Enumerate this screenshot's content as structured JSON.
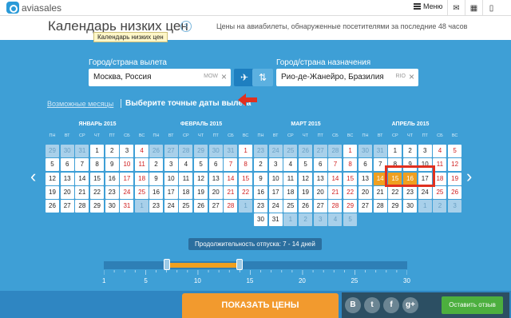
{
  "topbar": {
    "logo_text": "aviasales",
    "menu_label": "Меню",
    "icons": [
      "mail-icon",
      "calculator-icon",
      "mobile-icon"
    ]
  },
  "header": {
    "title": "Календарь низких цен",
    "help": "?",
    "subtitle": "Цены на авиабилеты, обнаруженные посетителями за последние 48 часов",
    "tooltip": "Календарь низких цен"
  },
  "search": {
    "origin_label": "Город/страна вылета",
    "origin_value": "Москва, Россия",
    "origin_code": "MOW",
    "dest_label": "Город/страна назначения",
    "dest_value": "Рио-де-Жанейро, Бразилия",
    "dest_code": "RIO",
    "clear_glyph": "×",
    "plane_glyph": "✈",
    "swap_glyph": "⇅"
  },
  "modes": {
    "months_link": "Возможные месяцы",
    "dates_active": "Выберите точные даты вылета"
  },
  "weekdays": [
    "ПН",
    "ВТ",
    "СР",
    "ЧТ",
    "ПТ",
    "СБ",
    "ВС"
  ],
  "months": [
    {
      "name": "ЯНВАРЬ 2015",
      "days": [
        [
          "29",
          "d"
        ],
        [
          "30",
          "d"
        ],
        [
          "31",
          "d"
        ],
        [
          "1",
          ""
        ],
        [
          "2",
          ""
        ],
        [
          "3",
          ""
        ],
        [
          "4",
          "w"
        ],
        [
          "5",
          ""
        ],
        [
          "6",
          ""
        ],
        [
          "7",
          ""
        ],
        [
          "8",
          ""
        ],
        [
          "9",
          ""
        ],
        [
          "10",
          "w"
        ],
        [
          "11",
          "w"
        ],
        [
          "12",
          ""
        ],
        [
          "13",
          ""
        ],
        [
          "14",
          ""
        ],
        [
          "15",
          ""
        ],
        [
          "16",
          ""
        ],
        [
          "17",
          "w"
        ],
        [
          "18",
          "w"
        ],
        [
          "19",
          ""
        ],
        [
          "20",
          ""
        ],
        [
          "21",
          ""
        ],
        [
          "22",
          ""
        ],
        [
          "23",
          ""
        ],
        [
          "24",
          "w"
        ],
        [
          "25",
          "w"
        ],
        [
          "26",
          ""
        ],
        [
          "27",
          ""
        ],
        [
          "28",
          ""
        ],
        [
          "29",
          ""
        ],
        [
          "30",
          ""
        ],
        [
          "31",
          "w"
        ],
        [
          "1",
          "d"
        ]
      ]
    },
    {
      "name": "ФЕВРАЛЬ 2015",
      "days": [
        [
          "26",
          "d"
        ],
        [
          "27",
          "d"
        ],
        [
          "28",
          "d"
        ],
        [
          "29",
          "d"
        ],
        [
          "30",
          "d"
        ],
        [
          "31",
          "d"
        ],
        [
          "1",
          "w"
        ],
        [
          "2",
          ""
        ],
        [
          "3",
          ""
        ],
        [
          "4",
          ""
        ],
        [
          "5",
          ""
        ],
        [
          "6",
          ""
        ],
        [
          "7",
          "w"
        ],
        [
          "8",
          "w"
        ],
        [
          "9",
          ""
        ],
        [
          "10",
          ""
        ],
        [
          "11",
          ""
        ],
        [
          "12",
          ""
        ],
        [
          "13",
          ""
        ],
        [
          "14",
          "w"
        ],
        [
          "15",
          "w"
        ],
        [
          "16",
          ""
        ],
        [
          "17",
          ""
        ],
        [
          "18",
          ""
        ],
        [
          "19",
          ""
        ],
        [
          "20",
          ""
        ],
        [
          "21",
          "w"
        ],
        [
          "22",
          "w"
        ],
        [
          "23",
          ""
        ],
        [
          "24",
          ""
        ],
        [
          "25",
          ""
        ],
        [
          "26",
          ""
        ],
        [
          "27",
          ""
        ],
        [
          "28",
          "w"
        ],
        [
          "1",
          "d"
        ]
      ]
    },
    {
      "name": "МАРТ 2015",
      "days": [
        [
          "23",
          "d"
        ],
        [
          "24",
          "d"
        ],
        [
          "25",
          "d"
        ],
        [
          "26",
          "d"
        ],
        [
          "27",
          "d"
        ],
        [
          "28",
          "d"
        ],
        [
          "1",
          "w"
        ],
        [
          "2",
          ""
        ],
        [
          "3",
          ""
        ],
        [
          "4",
          ""
        ],
        [
          "5",
          ""
        ],
        [
          "6",
          ""
        ],
        [
          "7",
          "w"
        ],
        [
          "8",
          "w"
        ],
        [
          "9",
          ""
        ],
        [
          "10",
          ""
        ],
        [
          "11",
          ""
        ],
        [
          "12",
          ""
        ],
        [
          "13",
          ""
        ],
        [
          "14",
          "w"
        ],
        [
          "15",
          "w"
        ],
        [
          "16",
          ""
        ],
        [
          "17",
          ""
        ],
        [
          "18",
          ""
        ],
        [
          "19",
          ""
        ],
        [
          "20",
          ""
        ],
        [
          "21",
          "w"
        ],
        [
          "22",
          "w"
        ],
        [
          "23",
          ""
        ],
        [
          "24",
          ""
        ],
        [
          "25",
          ""
        ],
        [
          "26",
          ""
        ],
        [
          "27",
          ""
        ],
        [
          "28",
          "w"
        ],
        [
          "29",
          "w"
        ],
        [
          "30",
          ""
        ],
        [
          "31",
          ""
        ],
        [
          "1",
          "d"
        ],
        [
          "2",
          "d"
        ],
        [
          "3",
          "d"
        ],
        [
          "4",
          "d"
        ],
        [
          "5",
          "d"
        ]
      ]
    },
    {
      "name": "АПРЕЛЬ 2015",
      "days": [
        [
          "30",
          "d"
        ],
        [
          "31",
          "d"
        ],
        [
          "1",
          ""
        ],
        [
          "2",
          ""
        ],
        [
          "3",
          ""
        ],
        [
          "4",
          "w"
        ],
        [
          "5",
          "w"
        ],
        [
          "6",
          ""
        ],
        [
          "7",
          ""
        ],
        [
          "8",
          ""
        ],
        [
          "9",
          ""
        ],
        [
          "10",
          ""
        ],
        [
          "11",
          "w"
        ],
        [
          "12",
          "w"
        ],
        [
          "13",
          ""
        ],
        [
          "14",
          "h"
        ],
        [
          "15",
          "h"
        ],
        [
          "16",
          "h"
        ],
        [
          "17",
          ""
        ],
        [
          "18",
          "w"
        ],
        [
          "19",
          "w"
        ],
        [
          "20",
          ""
        ],
        [
          "21",
          ""
        ],
        [
          "22",
          ""
        ],
        [
          "23",
          ""
        ],
        [
          "24",
          ""
        ],
        [
          "25",
          "w"
        ],
        [
          "26",
          "w"
        ],
        [
          "27",
          ""
        ],
        [
          "28",
          ""
        ],
        [
          "29",
          ""
        ],
        [
          "30",
          ""
        ],
        [
          "1",
          "d"
        ],
        [
          "2",
          "d"
        ],
        [
          "3",
          "d"
        ]
      ]
    }
  ],
  "duration": {
    "label": "Продолжительность отпуска: 7 - 14 дней",
    "min": 1,
    "max": 30,
    "from": 7,
    "to": 14,
    "tick_labels": [
      "1",
      "5",
      "10",
      "15",
      "20",
      "25",
      "30"
    ]
  },
  "footer": {
    "show_button": "ПОКАЗАТЬ ЦЕНЫ",
    "feedback_button": "Оставить отзыв",
    "social": [
      "В",
      "t",
      "f",
      "g+"
    ]
  },
  "colors": {
    "background": "#3e9fd6",
    "highlight": "#f0a020",
    "weekend": "#d02020",
    "annotation": "#e03020"
  }
}
